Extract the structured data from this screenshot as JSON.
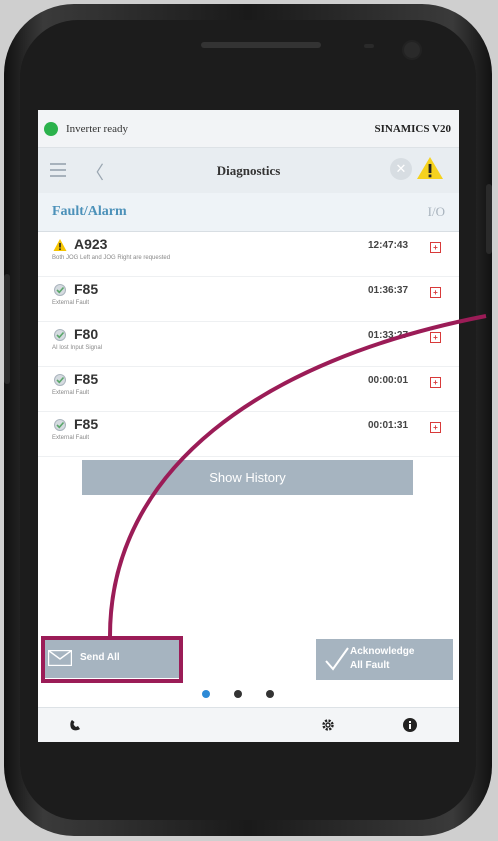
{
  "status_bar": {
    "status": "Inverter ready",
    "device": "SINAMICS V20",
    "status_color": "#2bb24c"
  },
  "header": {
    "title": "Diagnostics",
    "menu_icon": "hamburger-icon",
    "back_icon": "back-chevron-icon",
    "warning_icon": "warning-icon"
  },
  "section": {
    "title": "Fault/Alarm",
    "io_label": "I/O"
  },
  "faults": [
    {
      "icon": "alarm-warning-icon",
      "code": "A923",
      "desc": "Both JOG Left and JOG Right are requested",
      "time": "12:47:43"
    },
    {
      "icon": "fault-status-icon",
      "code": "F85",
      "desc": "External Fault",
      "time": "01:36:37"
    },
    {
      "icon": "fault-status-icon",
      "code": "F80",
      "desc": "AI lost Input Signal",
      "time": "01:33:27"
    },
    {
      "icon": "fault-status-icon",
      "code": "F85",
      "desc": "External Fault",
      "time": "00:00:01"
    },
    {
      "icon": "fault-status-icon",
      "code": "F85",
      "desc": "External Fault",
      "time": "00:01:31"
    }
  ],
  "buttons": {
    "history": "Show History",
    "send_all": "Send All",
    "ack_line1": "Acknowledge",
    "ack_line2": "All Fault"
  },
  "pager": {
    "count": 3,
    "active_index": 0
  },
  "bottom_nav": {
    "icons": [
      "phone-icon",
      "settings-icon",
      "info-icon"
    ]
  },
  "accent_colors": {
    "section_title": "#4c91b9",
    "highlight": "#9b1c57",
    "button": "#a6b4c0"
  }
}
